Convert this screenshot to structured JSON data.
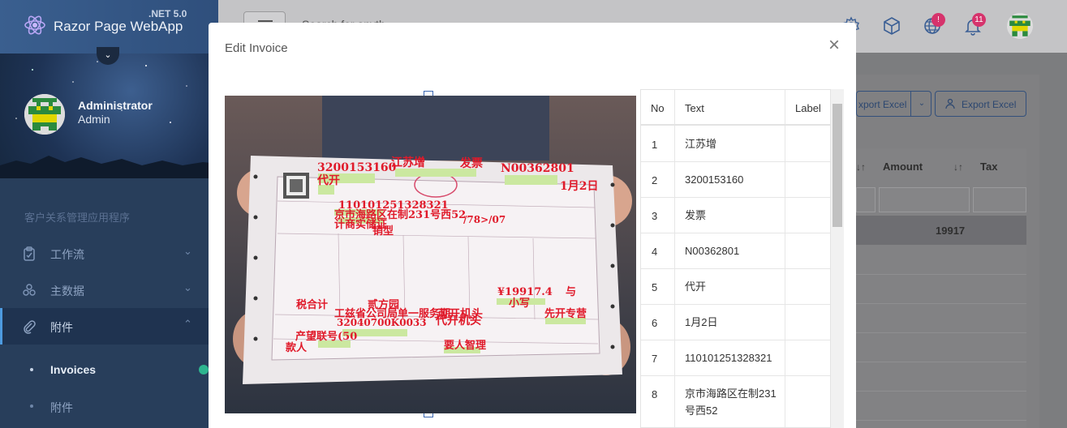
{
  "app": {
    "name": "Razor Page WebApp",
    "version": ".NET 5.0"
  },
  "user": {
    "name": "Administrator",
    "role": "Admin"
  },
  "sidebar": {
    "section_title": "客户关系管理应用程序",
    "items": [
      {
        "label": "工作流",
        "icon": "clipboard-icon"
      },
      {
        "label": "主数据",
        "icon": "cubes-icon"
      },
      {
        "label": "附件",
        "icon": "paperclip-icon"
      }
    ],
    "subitems": [
      {
        "label": "Invoices"
      },
      {
        "label": "附件"
      }
    ]
  },
  "header": {
    "search_placeholder": "Search for anything...",
    "search_visible": "Search for anyth...",
    "badges": {
      "globe": "!",
      "notifications": "11"
    }
  },
  "background_page": {
    "buttons": {
      "export_left": "xport Excel",
      "export_right": "Export Excel"
    },
    "columns": {
      "amount": "Amount",
      "tax": "Tax"
    },
    "highlight_value": "19917"
  },
  "modal": {
    "title": "Edit Invoice",
    "close_symbol": "×",
    "grid": {
      "columns": {
        "no": "No",
        "text": "Text",
        "label": "Label"
      },
      "rows": [
        {
          "no": "1",
          "text": "江苏增",
          "label": ""
        },
        {
          "no": "2",
          "text": "3200153160",
          "label": ""
        },
        {
          "no": "3",
          "text": "发票",
          "label": ""
        },
        {
          "no": "4",
          "text": "N00362801",
          "label": ""
        },
        {
          "no": "5",
          "text": "代开",
          "label": ""
        },
        {
          "no": "6",
          "text": "1月2日",
          "label": ""
        },
        {
          "no": "7",
          "text": "110101251328321",
          "label": ""
        },
        {
          "no": "8",
          "text": "京市海路区在制231号西52",
          "label": ""
        }
      ]
    },
    "ocr_labels": [
      "3200153160",
      "江苏增",
      "发票",
      "N00362801",
      "代开",
      "1月2日",
      "110101251328321",
      "京市海路区在制231号西52",
      "/78>/07",
      "计商实储证",
      "销型",
      "税合计",
      "贰方园",
      "工兹省公司局单一服务期",
      "可开机头",
      "¥19917.4",
      "与",
      "小写",
      "先开专营",
      "32040700K0033",
      "产望联号(50",
      "代开机头",
      "款人",
      "要人智理"
    ],
    "accent_color": "#e01a2a"
  }
}
